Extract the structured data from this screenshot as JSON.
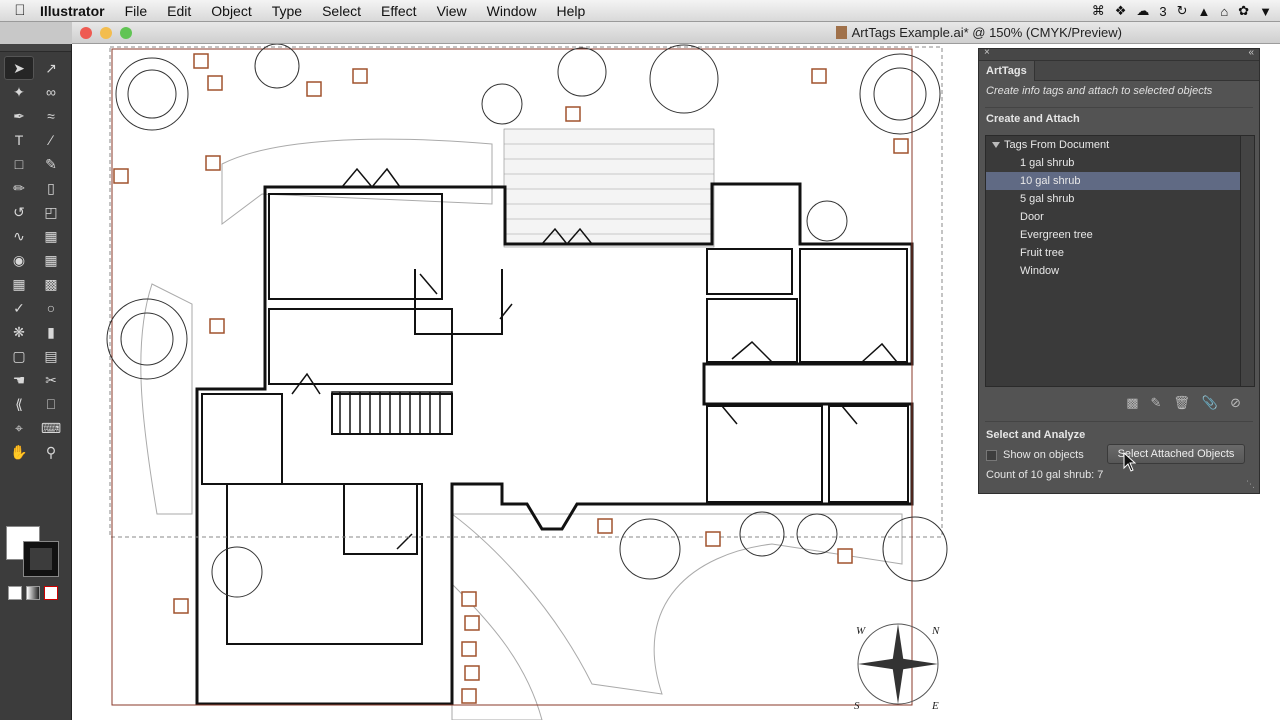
{
  "menubar": {
    "app_name": "Illustrator",
    "items": [
      "File",
      "Edit",
      "Object",
      "Type",
      "Select",
      "Effect",
      "View",
      "Window",
      "Help"
    ],
    "status": {
      "badge_count": "3"
    }
  },
  "document": {
    "title": "ArtTags Example.ai* @ 150% (CMYK/Preview)"
  },
  "panel": {
    "tab_title": "ArtTags",
    "description": "Create info tags and attach to selected objects",
    "section_create": "Create and Attach",
    "tag_group": "Tags From Document",
    "tags": [
      "1 gal shrub",
      "10 gal shrub",
      "5 gal shrub",
      "Door",
      "Evergreen tree",
      "Fruit tree",
      "Window"
    ],
    "selected_tag": "10 gal shrub",
    "section_select": "Select and Analyze",
    "show_on_objects_label": "Show on objects",
    "show_on_objects_checked": false,
    "select_attached_button": "Select Attached Objects",
    "count_text": "Count of 10 gal shrub: 7",
    "icons": [
      "new-tag-icon",
      "edit-tag-icon",
      "delete-tag-icon",
      "attach-tag-icon",
      "detach-tag-icon"
    ]
  },
  "colors": {
    "panel_bg": "#535353",
    "selection": "#606a84",
    "tag_marker": "#a0522d",
    "toolbar_bg": "#3c3c3c"
  },
  "canvas": {
    "zoom": "150%",
    "compass_labels": [
      "W",
      "N",
      "S",
      "E"
    ]
  }
}
